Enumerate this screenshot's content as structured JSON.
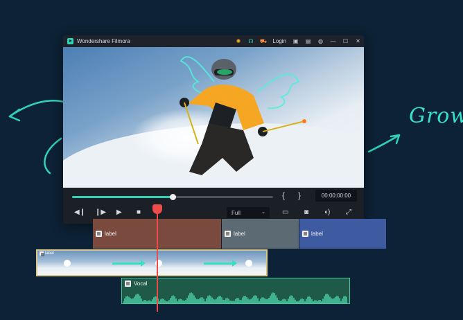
{
  "app": {
    "title": "Wondershare Filmora",
    "login_label": "Login"
  },
  "decoration": {
    "grow_text": "Grow"
  },
  "player": {
    "timecode": "00:00:00:00",
    "zoom_value": "Full",
    "progress": 0.5
  },
  "timeline": {
    "title_clips": [
      {
        "label": "label",
        "color": "#7a4a3f"
      },
      {
        "label": "label",
        "color": "#5c6a74"
      },
      {
        "label": "label",
        "color": "#3e5aa0"
      }
    ],
    "video_clip_label": "label",
    "audio_clip_label": "Vocal"
  },
  "colors": {
    "accent": "#2fd3b8",
    "playhead": "#ee4b4b",
    "background": "#0d2236"
  },
  "icons": {
    "hint": "bulb-icon",
    "support": "headset-icon",
    "cart": "cart-icon",
    "save": "save-icon",
    "notify": "bell-icon",
    "account": "user-icon",
    "minimize": "minimize-icon",
    "maximize": "maximize-icon",
    "close": "close-icon"
  }
}
